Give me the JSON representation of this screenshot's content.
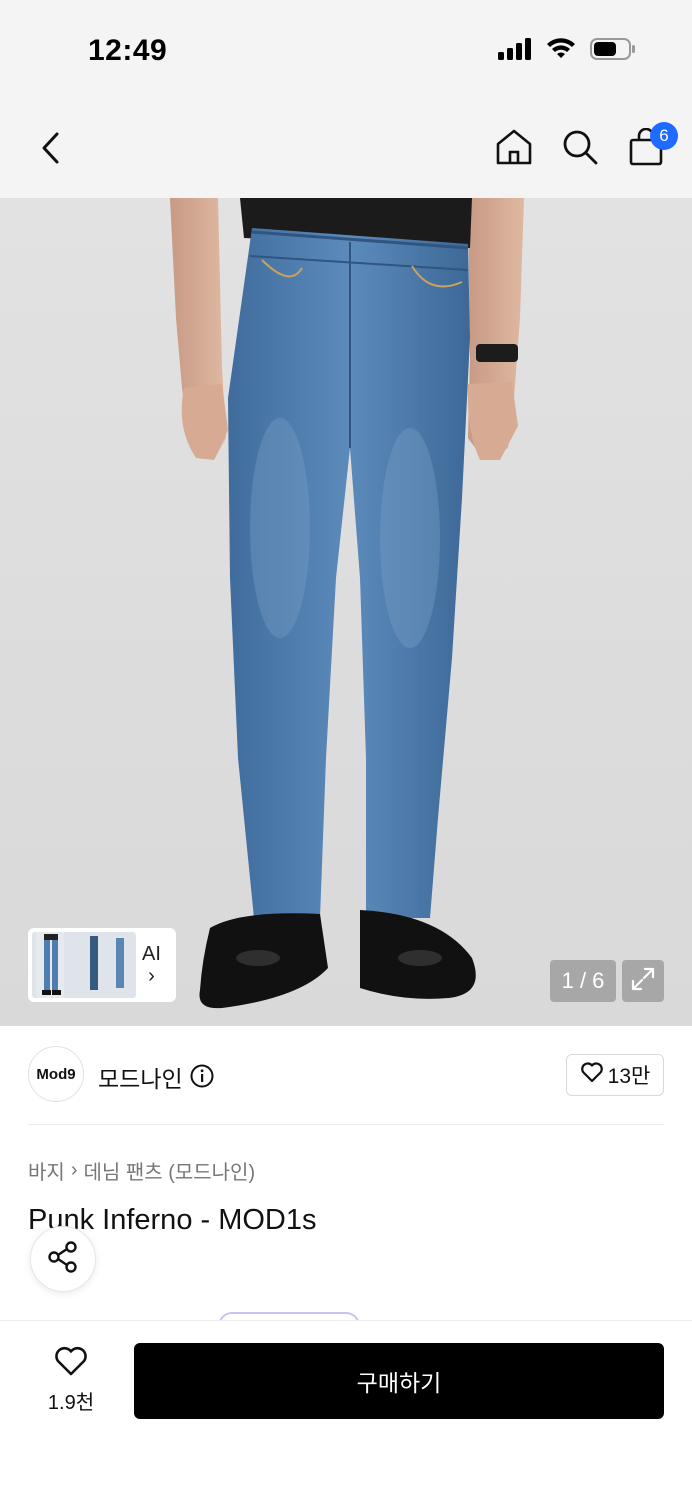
{
  "status_bar": {
    "time": "12:49",
    "icons": [
      "signal-icon",
      "wifi-icon",
      "battery-icon"
    ]
  },
  "nav": {
    "back_icon": "chevron-left-icon",
    "home_icon": "home-icon",
    "search_icon": "search-icon",
    "cart_icon": "shopping-bag-icon",
    "cart_count": "6"
  },
  "gallery": {
    "ai_label": "AI",
    "ai_arrow": "›",
    "page_indicator": "1 / 6",
    "expand_icon": "expand-icon"
  },
  "brand": {
    "logo_text": "Mod9",
    "name": "모드나인",
    "info_icon": "info-icon",
    "likes": "13만"
  },
  "product": {
    "breadcrumb": [
      "바지",
      "데님 팬츠 (모드나인)"
    ],
    "breadcrumb_separator": "›",
    "title": "Punk Inferno - MOD1s"
  },
  "bottom_bar": {
    "wish_count": "1.9천",
    "buy_label": "구매하기"
  },
  "colors": {
    "accent_badge": "#1f6bff",
    "buy_button": "#000000",
    "denim": "#4f7eae"
  }
}
